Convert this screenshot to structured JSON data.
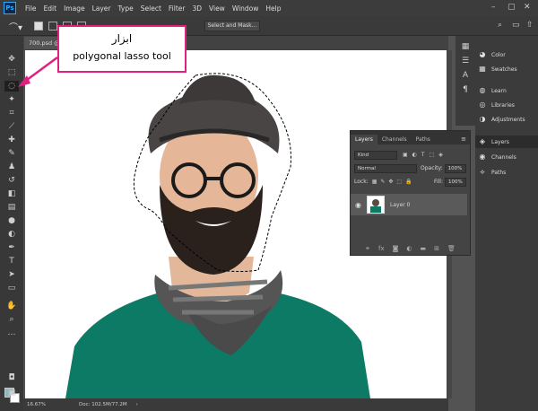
{
  "app": {
    "logo": "Ps"
  },
  "menu": [
    "File",
    "Edit",
    "Image",
    "Layer",
    "Type",
    "Select",
    "Filter",
    "3D",
    "View",
    "Window",
    "Help"
  ],
  "options_bar": {
    "select_and_mask_label": "Select and Mask..."
  },
  "document": {
    "tab_label": "700.psd @ 16.7%",
    "zoom": "16.67%",
    "doc_info": "Doc: 102.5M/77.2M"
  },
  "annotation": {
    "persian_label": "ابزار",
    "english_label": "polygonal lasso tool",
    "accent": "#e0217f"
  },
  "layers_panel": {
    "tabs": [
      "Layers",
      "Channels",
      "Paths"
    ],
    "kind_label": "Kind",
    "blend_mode": "Normal",
    "opacity_label": "Opacity:",
    "opacity_value": "100%",
    "lock_label": "Lock:",
    "fill_label": "Fill:",
    "fill_value": "100%",
    "layer_name": "Layer 0"
  },
  "right_dock": {
    "items": [
      "Color",
      "Swatches",
      "Learn",
      "Libraries",
      "Adjustments",
      "Layers",
      "Channels",
      "Paths"
    ]
  },
  "colors": {
    "foreground": "#8fb7c0",
    "background": "#ffffff",
    "sweater": "#0d7a66"
  }
}
